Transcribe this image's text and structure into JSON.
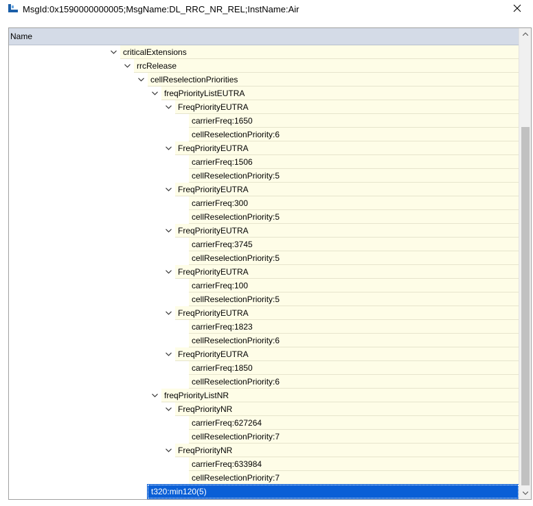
{
  "window": {
    "title": "MsgId:0x1590000000005;MsgName:DL_RRC_NR_REL;InstName:Air"
  },
  "columns": {
    "name": "Name"
  },
  "tree": [
    {
      "label": "criticalExtensions",
      "level": 0,
      "expanded": true
    },
    {
      "label": "rrcRelease",
      "level": 1,
      "expanded": true
    },
    {
      "label": "cellReselectionPriorities",
      "level": 2,
      "expanded": true
    },
    {
      "label": "freqPriorityListEUTRA",
      "level": 3,
      "expanded": true
    },
    {
      "label": "FreqPriorityEUTRA",
      "level": 4,
      "expanded": true
    },
    {
      "label": "carrierFreq:1650",
      "level": 5,
      "expanded": null
    },
    {
      "label": "cellReselectionPriority:6",
      "level": 5,
      "expanded": null
    },
    {
      "label": "FreqPriorityEUTRA",
      "level": 4,
      "expanded": true
    },
    {
      "label": "carrierFreq:1506",
      "level": 5,
      "expanded": null
    },
    {
      "label": "cellReselectionPriority:5",
      "level": 5,
      "expanded": null
    },
    {
      "label": "FreqPriorityEUTRA",
      "level": 4,
      "expanded": true
    },
    {
      "label": "carrierFreq:300",
      "level": 5,
      "expanded": null
    },
    {
      "label": "cellReselectionPriority:5",
      "level": 5,
      "expanded": null
    },
    {
      "label": "FreqPriorityEUTRA",
      "level": 4,
      "expanded": true
    },
    {
      "label": "carrierFreq:3745",
      "level": 5,
      "expanded": null
    },
    {
      "label": "cellReselectionPriority:5",
      "level": 5,
      "expanded": null
    },
    {
      "label": "FreqPriorityEUTRA",
      "level": 4,
      "expanded": true
    },
    {
      "label": "carrierFreq:100",
      "level": 5,
      "expanded": null
    },
    {
      "label": "cellReselectionPriority:5",
      "level": 5,
      "expanded": null
    },
    {
      "label": "FreqPriorityEUTRA",
      "level": 4,
      "expanded": true
    },
    {
      "label": "carrierFreq:1823",
      "level": 5,
      "expanded": null
    },
    {
      "label": "cellReselectionPriority:6",
      "level": 5,
      "expanded": null
    },
    {
      "label": "FreqPriorityEUTRA",
      "level": 4,
      "expanded": true
    },
    {
      "label": "carrierFreq:1850",
      "level": 5,
      "expanded": null
    },
    {
      "label": "cellReselectionPriority:6",
      "level": 5,
      "expanded": null
    },
    {
      "label": "freqPriorityListNR",
      "level": 3,
      "expanded": true
    },
    {
      "label": "FreqPriorityNR",
      "level": 4,
      "expanded": true
    },
    {
      "label": "carrierFreq:627264",
      "level": 5,
      "expanded": null
    },
    {
      "label": "cellReselectionPriority:7",
      "level": 5,
      "expanded": null
    },
    {
      "label": "FreqPriorityNR",
      "level": 4,
      "expanded": true
    },
    {
      "label": "carrierFreq:633984",
      "level": 5,
      "expanded": null
    },
    {
      "label": "cellReselectionPriority:7",
      "level": 5,
      "expanded": null
    },
    {
      "label": "t320:min120(5)",
      "level": 2,
      "expanded": null,
      "selected": true
    }
  ],
  "icons": {
    "app": "tree-app-icon",
    "close": "close-icon",
    "expand": "chevron-down-icon",
    "scroll_up": "scroll-up-arrow-icon",
    "scroll_down": "scroll-down-arrow-icon"
  },
  "colors": {
    "row_background": "#fefde7",
    "header_background": "#d4dbe7",
    "selection": "#0a5fd6"
  }
}
